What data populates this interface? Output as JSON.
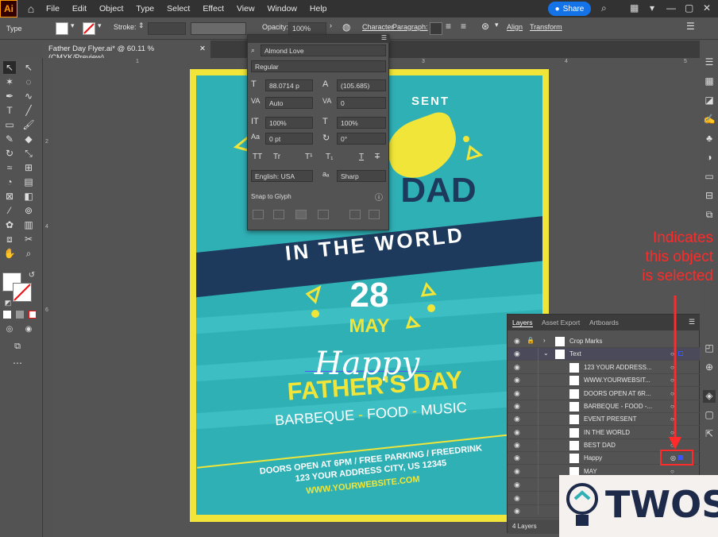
{
  "menubar": {
    "items": [
      "File",
      "Edit",
      "Object",
      "Type",
      "Select",
      "Effect",
      "View",
      "Window",
      "Help"
    ],
    "share": "Share"
  },
  "control": {
    "type_label": "Type",
    "stroke_label": "Stroke:",
    "opacity_label": "Opacity:",
    "opacity_value": "100%",
    "character": "Character",
    "paragraph": "Paragraph:",
    "align": "Align",
    "transform": "Transform"
  },
  "document_tab": "Father Day Flyer.ai* @ 60.11 % (CMYK/Preview)",
  "ruler": {
    "t1": "1",
    "t2": "2",
    "t3": "3",
    "t4": "4",
    "t5": "5",
    "l1": "2",
    "l2": "4",
    "l3": "6"
  },
  "character_panel": {
    "font": "Almond Love",
    "style": "Regular",
    "size": "88.0714 p",
    "leading": "(105.685)",
    "kerning": "Auto",
    "tracking": "0",
    "vscale": "100%",
    "hscale": "100%",
    "baseline": "0 pt",
    "rotation": "0°",
    "language": "English: USA",
    "aa": "Sharp",
    "snap": "Snap to Glyph"
  },
  "poster": {
    "present": "SENT",
    "best_dad": "DAD",
    "world": "IN THE WORLD",
    "day": "28",
    "month": "MAY",
    "happy": "Happy",
    "fathers_day": "FATHER'S DAY",
    "tagline_1": "BARBEQUE",
    "tagline_dash_1": " - ",
    "tagline_2": "FOOD",
    "tagline_dash_2": " - ",
    "tagline_3": "MUSIC",
    "doors": "DOORS OPEN AT 6PM / FREE PARKING / FREEDRINK",
    "address": "123 YOUR ADDRESS CITY, US 12345",
    "website": "WWW.YOURWEBSITE.COM"
  },
  "layers_panel": {
    "tabs": [
      "Layers",
      "Asset Export",
      "Artboards"
    ],
    "rows": [
      "Crop Marks",
      "Text",
      "123 YOUR ADDRESS...",
      "WWW.YOURWEBSIT...",
      "DOORS OPEN AT 6R...",
      "BARBEQUE - FOOD -...",
      "EVENT PRESENT",
      "IN THE WORLD",
      "BEST DAD",
      "Happy",
      "MAY"
    ],
    "footer": "4 Layers"
  },
  "annotation": {
    "line1": "Indicates",
    "line2": "this object",
    "line3": "is selected"
  },
  "watermark": "TWOS",
  "colors": {
    "poster_teal": "#2fb0b5",
    "poster_yellow": "#f0e538",
    "banner_navy": "#1d3a5c",
    "annot_red": "#ff2a2a"
  }
}
